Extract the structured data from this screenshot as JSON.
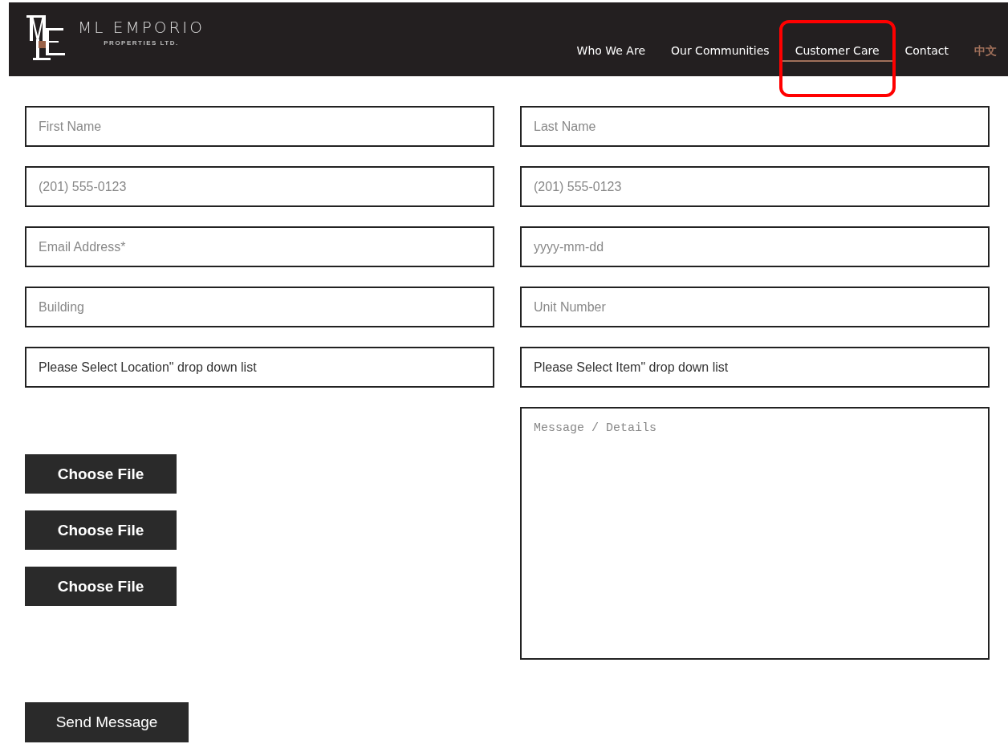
{
  "logo": {
    "name": "ML EMPORIO",
    "tagline": "PROPERTIES LTD."
  },
  "nav": [
    {
      "label": "Who We Are",
      "selected": false,
      "highlighted": false,
      "kind": "link"
    },
    {
      "label": "Our Communities",
      "selected": false,
      "highlighted": false,
      "kind": "link"
    },
    {
      "label": "Customer Care",
      "selected": true,
      "highlighted": true,
      "kind": "link"
    },
    {
      "label": "Contact",
      "selected": false,
      "highlighted": false,
      "kind": "link"
    },
    {
      "label": "中文",
      "selected": false,
      "highlighted": false,
      "kind": "language"
    }
  ],
  "fields": [
    {
      "placeholder": "First Name",
      "kind": "input"
    },
    {
      "placeholder": "Last Name",
      "kind": "input"
    },
    {
      "placeholder": "(201) 555-0123",
      "kind": "input"
    },
    {
      "placeholder": "(201) 555-0123",
      "kind": "input"
    },
    {
      "placeholder": "Email Address*",
      "kind": "input"
    },
    {
      "placeholder": "yyyy-mm-dd",
      "kind": "input"
    },
    {
      "placeholder": "Building",
      "kind": "input"
    },
    {
      "placeholder": "Unit Number",
      "kind": "input"
    },
    {
      "value": "Please Select Location\" drop down list",
      "kind": "select"
    },
    {
      "value": "Please Select Item\" drop down list",
      "kind": "select"
    }
  ],
  "file_buttons": [
    "Choose File",
    "Choose File",
    "Choose File"
  ],
  "message": {
    "placeholder": "Message / Details"
  },
  "submit": "Send Message"
}
